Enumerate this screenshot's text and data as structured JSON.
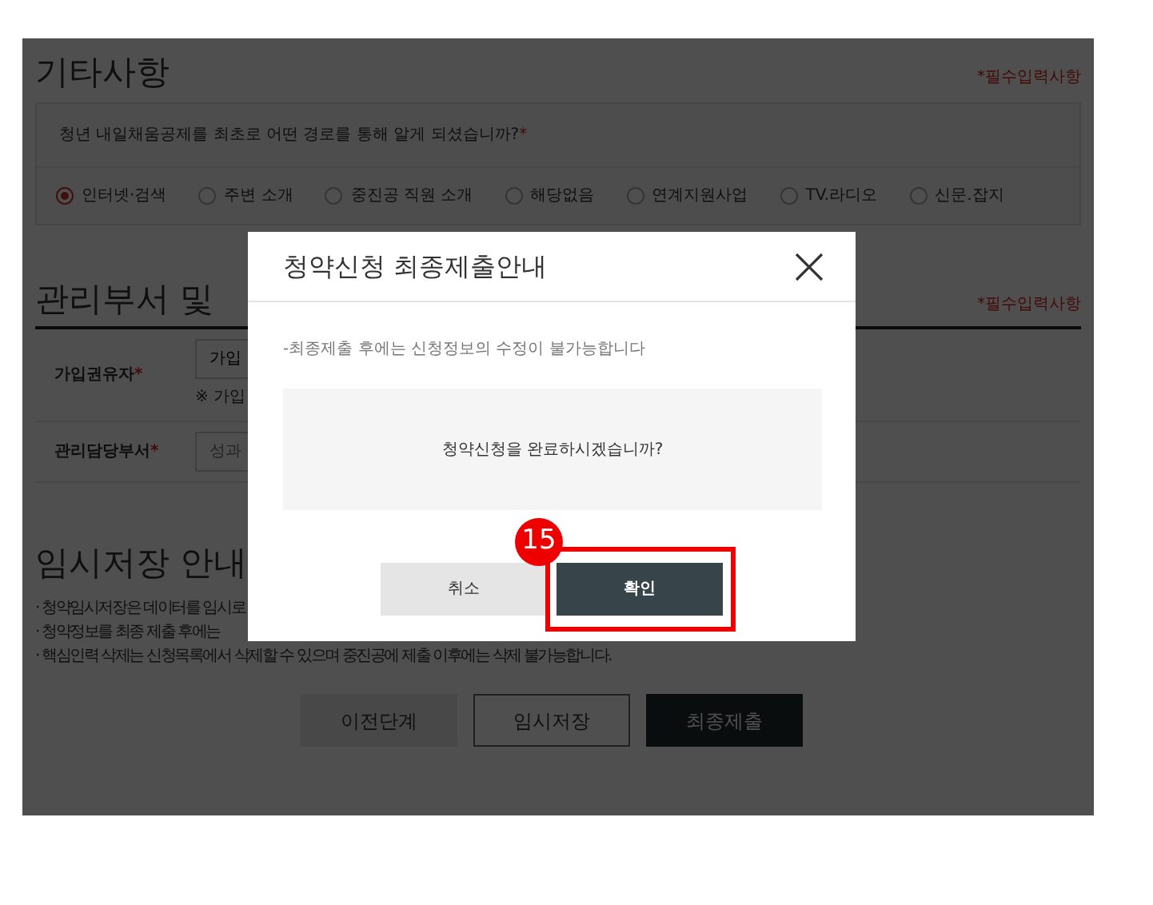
{
  "other": {
    "title": "기타사항",
    "required_note": "*필수입력사항",
    "question": "청년 내일채움공제를 최초로 어떤 경로를 통해 알게 되셨습니까?",
    "required_mark": "*",
    "options": [
      {
        "label": "인터넷·검색",
        "selected": true
      },
      {
        "label": "주변 소개",
        "selected": false
      },
      {
        "label": "중진공 직원 소개",
        "selected": false
      },
      {
        "label": "해당없음",
        "selected": false
      },
      {
        "label": "연계지원사업",
        "selected": false
      },
      {
        "label": "TV.라디오",
        "selected": false
      },
      {
        "label": "신문.잡지",
        "selected": false
      }
    ]
  },
  "management": {
    "title": "관리부서 및",
    "required_note": "*필수입력사항",
    "rows": [
      {
        "label": "가입권유자",
        "required_mark": "*",
        "value": "가입",
        "hint": "※ 가입"
      },
      {
        "label": "관리담당부서",
        "required_mark": "*",
        "placeholder": "성과"
      }
    ]
  },
  "temp_save": {
    "title": "임시저장 안내",
    "notes": [
      "· 청약임시저장은 데이터를 임시로",
      "· 청약정보를 최종 제출 후에는",
      "· 핵심인력 삭제는 신청목록에서 삭제할 수 있으며 중진공에 제출 이후에는 삭제 불가능합니다."
    ]
  },
  "actions": [
    {
      "label": "이전단계",
      "kind": "secondary"
    },
    {
      "label": "임시저장",
      "kind": "outline"
    },
    {
      "label": "최종제출",
      "kind": "primary"
    }
  ],
  "modal": {
    "title": "청약신청 최종제출안내",
    "notice": "-최종제출 후에는 신청정보의 수정이 불가능합니다",
    "question": "청약신청을 완료하시겠습니까?",
    "buttons": [
      {
        "label": "취소",
        "kind": "cancel",
        "highlighted": false
      },
      {
        "label": "확인",
        "kind": "confirm",
        "highlighted": true
      }
    ]
  },
  "annotation": {
    "number": "15"
  }
}
